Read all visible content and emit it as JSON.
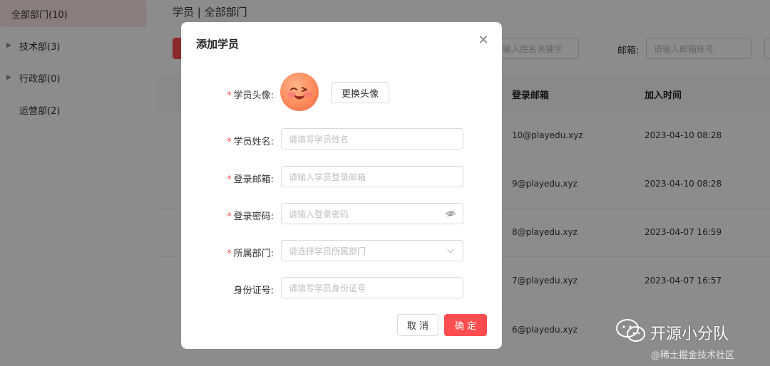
{
  "sidebar": {
    "items": [
      {
        "label": "全部部门(10)",
        "active": true
      },
      {
        "label": "技术部(3)",
        "expandable": true
      },
      {
        "label": "行政部(0)",
        "expandable": true
      },
      {
        "label": "运营部(2)",
        "expandable": false
      }
    ]
  },
  "header": {
    "breadcrumb": "学员 | 全部部门"
  },
  "filters": {
    "name_placeholder": "请输入姓名关键字",
    "email_label": "邮箱:",
    "email_placeholder": "请输入邮箱账号"
  },
  "table": {
    "columns": [
      "登录邮箱",
      "加入时间"
    ],
    "rows": [
      {
        "email": "10@playedu.xyz",
        "joined": "2023-04-10 08:28"
      },
      {
        "email": "9@playedu.xyz",
        "joined": "2023-04-10 08:28"
      },
      {
        "email": "8@playedu.xyz",
        "joined": "2023-04-07 16:59"
      },
      {
        "email": "7@playedu.xyz",
        "joined": "2023-04-07 16:57"
      },
      {
        "email": "6@playedu.xyz",
        "joined": ""
      }
    ]
  },
  "modal": {
    "title": "添加学员",
    "avatar_label": "学员头像:",
    "change_avatar": "更换头像",
    "name_label": "学员姓名:",
    "name_placeholder": "请填写学员姓名",
    "email_label": "登录邮箱:",
    "email_placeholder": "请输入学员登录邮箱",
    "password_label": "登录密码:",
    "password_placeholder": "请输入登录密码",
    "dept_label": "所属部门:",
    "dept_placeholder": "请选择学员所属部门",
    "idcard_label": "身份证号:",
    "idcard_placeholder": "请填写学员身份证号",
    "cancel": "取 消",
    "ok": "确 定"
  },
  "watermark": {
    "title": "开源小分队",
    "subtitle": "@稀土掘金技术社区"
  },
  "colors": {
    "accent": "#ff4d4f",
    "active_bg": "#fde3e3"
  }
}
